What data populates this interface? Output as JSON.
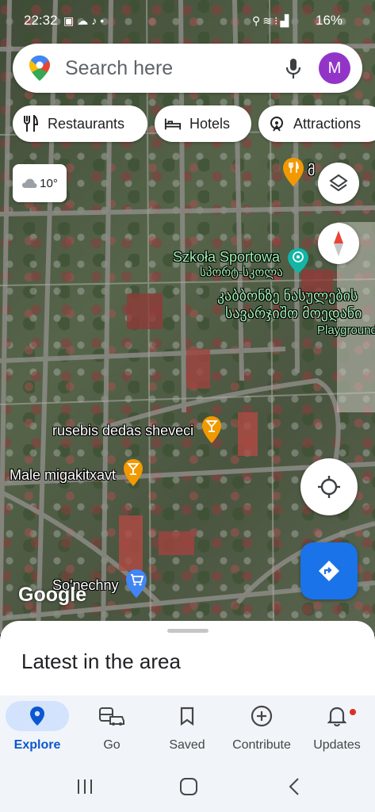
{
  "status_bar": {
    "time": "22:32",
    "left_icons": [
      "image-icon",
      "cloud-icon",
      "tiktok-icon",
      "dot-icon"
    ],
    "right_icons": [
      "location-icon",
      "wifi-icon",
      "volte-icon",
      "signal-icon"
    ],
    "battery": "16%"
  },
  "search": {
    "placeholder": "Search here",
    "avatar_letter": "M",
    "avatar_color": "#9334c9"
  },
  "chips": [
    {
      "label": "Restaurants",
      "icon": "fork-knife-icon"
    },
    {
      "label": "Hotels",
      "icon": "bed-icon"
    },
    {
      "label": "Attractions",
      "icon": "attraction-icon"
    }
  ],
  "weather": {
    "temp": "10°",
    "icon": "cloud-icon"
  },
  "map_labels": {
    "place_1": "Szkoła Sportowa",
    "place_1_local": "სპორტ-სკოლა",
    "place_2_line1": "კაბბონზე ნასულების",
    "place_2_line2": "სავარჯიშო მოედანი",
    "playground": "Playground",
    "bar_1": "rusebis dedas sheveci",
    "bar_2": "Male migakitxavt",
    "shop": "So'nechny",
    "restaurant_partial": "მ"
  },
  "google_logo": "Google",
  "bottom_sheet": {
    "title": "Latest in the area"
  },
  "nav": {
    "items": [
      {
        "label": "Explore",
        "icon": "explore-pin-icon",
        "active": true
      },
      {
        "label": "Go",
        "icon": "car-bus-icon",
        "active": false
      },
      {
        "label": "Saved",
        "icon": "bookmark-icon",
        "active": false
      },
      {
        "label": "Contribute",
        "icon": "add-circle-icon",
        "active": false
      },
      {
        "label": "Updates",
        "icon": "bell-icon",
        "active": false
      }
    ]
  },
  "colors": {
    "accent": "#1a73e8",
    "active_nav": "#0b57d0",
    "notification": "#d93025"
  }
}
